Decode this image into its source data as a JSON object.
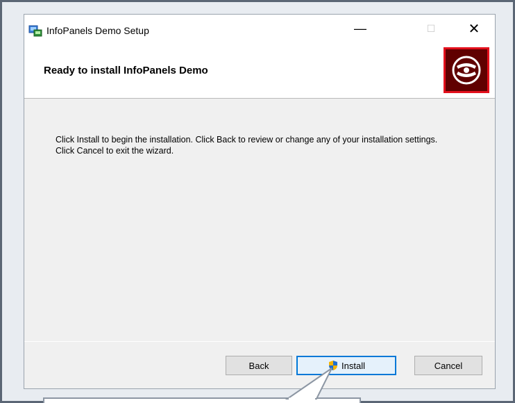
{
  "window": {
    "title": "InfoPanels Demo Setup",
    "minimize_glyph": "—",
    "maximize_glyph": "☐",
    "close_glyph": "✕"
  },
  "header": {
    "heading": "Ready to install InfoPanels Demo",
    "logo_icon": "disc-icon"
  },
  "main": {
    "description": "Click Install to begin the installation. Click Back to review or change any of your installation settings. Click Cancel to exit the wizard."
  },
  "footer": {
    "back_label": "Back",
    "install_label": "Install",
    "cancel_label": "Cancel"
  },
  "colors": {
    "accent": "#0078d7",
    "logo_red": "#e3101c",
    "logo_dark": "#600000"
  }
}
